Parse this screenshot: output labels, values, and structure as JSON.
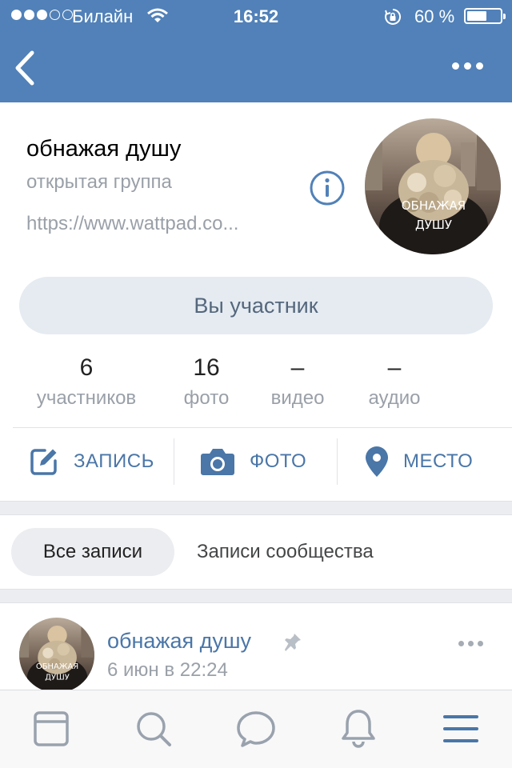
{
  "status_bar": {
    "carrier": "Билайн",
    "time": "16:52",
    "battery": "60 %",
    "battery_level": 0.6,
    "signal_bars_filled": 3,
    "signal_bars_total": 5
  },
  "nav": {
    "back_icon": "chevron-left-icon",
    "more_icon": "more-horizontal-icon"
  },
  "group": {
    "name": "обнажая душу",
    "type": "открытая группа",
    "link": "https://www.wattpad.co...",
    "avatar_caption_1": "ОБНАЖАЯ",
    "avatar_caption_2": "ДУШУ",
    "member_button": "Вы участник"
  },
  "counters": [
    {
      "value": "6",
      "label": "участников"
    },
    {
      "value": "16",
      "label": "фото"
    },
    {
      "value": "–",
      "label": "видео"
    },
    {
      "value": "–",
      "label": "аудио"
    }
  ],
  "actions": [
    {
      "label": "ЗАПИСЬ",
      "icon": "edit-icon"
    },
    {
      "label": "ФОТО",
      "icon": "camera-icon"
    },
    {
      "label": "МЕСТО",
      "icon": "location-pin-icon"
    }
  ],
  "wall_tabs": {
    "all": "Все записи",
    "community": "Записи сообщества"
  },
  "post": {
    "author": "обнажая душу",
    "date": "6 июн в 22:24",
    "avatar_caption_1": "ОБНАЖАЯ",
    "avatar_caption_2": "ДУШУ"
  },
  "tabbar": {
    "items": [
      "news-icon",
      "search-icon",
      "messages-icon",
      "notifications-icon",
      "menu-icon"
    ],
    "active": "menu-icon"
  },
  "colors": {
    "header": "#5181b8",
    "accent": "#4a76a8",
    "muted": "#9aa0a8",
    "button_bg": "#e5ebf1",
    "active_tab": "#4a76a8",
    "inactive_tab": "#99a2ad"
  }
}
